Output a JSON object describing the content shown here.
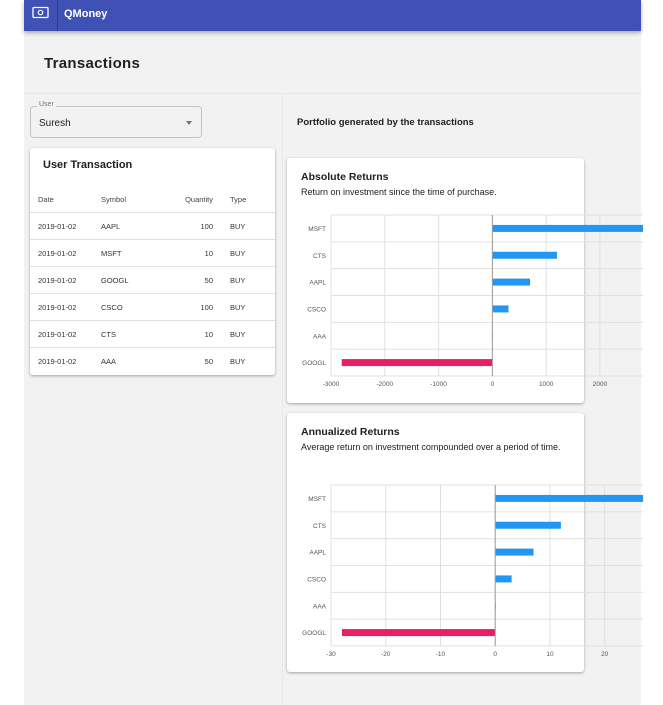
{
  "app": {
    "title": "QMoney",
    "logo_icon": "money-bill-icon",
    "brand_color": "#3f51b5"
  },
  "page": {
    "title": "Transactions"
  },
  "user_select": {
    "label": "User",
    "value": "Suresh"
  },
  "transactions": {
    "title": "User Transaction",
    "headers": {
      "date": "Date",
      "symbol": "Symbol",
      "quantity": "Quantity",
      "type": "Type"
    },
    "rows": [
      {
        "date": "2019-01-02",
        "symbol": "AAPL",
        "quantity": "100",
        "type": "BUY"
      },
      {
        "date": "2019-01-02",
        "symbol": "MSFT",
        "quantity": "10",
        "type": "BUY"
      },
      {
        "date": "2019-01-02",
        "symbol": "GOOGL",
        "quantity": "50",
        "type": "BUY"
      },
      {
        "date": "2019-01-02",
        "symbol": "CSCO",
        "quantity": "100",
        "type": "BUY"
      },
      {
        "date": "2019-01-02",
        "symbol": "CTS",
        "quantity": "10",
        "type": "BUY"
      },
      {
        "date": "2019-01-02",
        "symbol": "AAA",
        "quantity": "50",
        "type": "BUY"
      }
    ]
  },
  "portfolio": {
    "label": "Portfolio generated by the transactions"
  },
  "absolute_card": {
    "title": "Absolute Returns",
    "subtitle": "Return on investment since the time of purchase."
  },
  "annualized_card": {
    "title": "Annualized Returns",
    "subtitle": "Average return on investment compounded over a period of time."
  },
  "colors": {
    "positive": "#2196f3",
    "negative": "#e91e63",
    "grid": "#e0e0e0"
  },
  "chart_data": [
    {
      "type": "bar",
      "orientation": "horizontal",
      "categories": [
        "MSFT",
        "CTS",
        "AAPL",
        "CSCO",
        "AAA",
        "GOOGL"
      ],
      "values": [
        2800,
        1200,
        700,
        300,
        0,
        -2800
      ],
      "xlim": [
        -3000,
        2800
      ],
      "xticks": [
        "-3000",
        "-2000",
        "-1000",
        "0",
        "1000",
        "2000"
      ],
      "grid": true
    },
    {
      "type": "bar",
      "orientation": "horizontal",
      "categories": [
        "MSFT",
        "CTS",
        "AAPL",
        "CSCO",
        "AAA",
        "GOOGL"
      ],
      "values": [
        27,
        12,
        7,
        3,
        0,
        -28
      ],
      "xlim": [
        -30,
        27
      ],
      "xticks": [
        "-30",
        "-20",
        "-10",
        "0",
        "10",
        "20"
      ],
      "grid": true
    }
  ]
}
